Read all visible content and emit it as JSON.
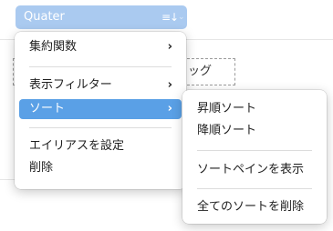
{
  "field_pill": {
    "label": "Quater",
    "sort_icon": "≡↓",
    "menu_chevron": "⌄"
  },
  "background": {
    "drop_zone_text": "ッグ"
  },
  "context_menu": {
    "items": [
      {
        "label": "集約関数",
        "has_submenu": true,
        "arrow": "›"
      },
      {
        "label": "表示フィルター",
        "has_submenu": true,
        "arrow": "›"
      },
      {
        "label": "ソート",
        "has_submenu": true,
        "arrow": "›",
        "active": true
      },
      {
        "label": "エイリアスを設定",
        "has_submenu": false
      },
      {
        "label": "削除",
        "has_submenu": false
      }
    ]
  },
  "sort_submenu": {
    "items": [
      {
        "label": "昇順ソート"
      },
      {
        "label": "降順ソート"
      },
      {
        "label": "ソートペインを表示"
      },
      {
        "label": "全てのソートを削除"
      }
    ]
  },
  "colors": {
    "pill_bg": "#aacaf0",
    "highlight": "#5aa0e6"
  }
}
